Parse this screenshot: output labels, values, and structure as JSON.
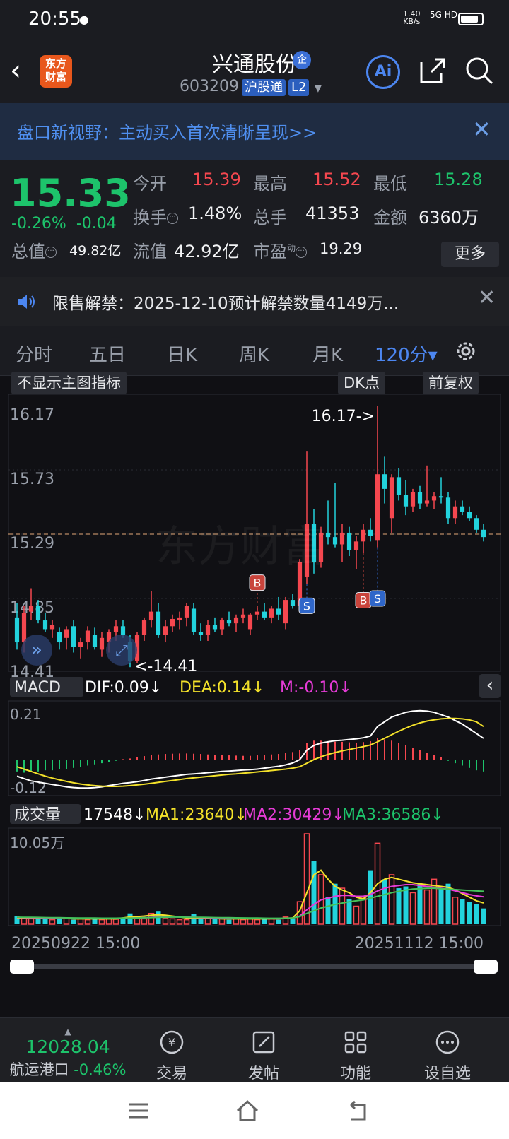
{
  "status_bar": {
    "time": "20:55",
    "rate_value": "1.40",
    "rate_unit": "KB/s",
    "network": "5G HD"
  },
  "header": {
    "title": "兴通股份",
    "badge": "企",
    "code": "603209",
    "exchange_tag": "沪股通",
    "level_tag": "L2",
    "logo_line1": "东方",
    "logo_line2": "财富",
    "ai_label": "Ai"
  },
  "banner": {
    "text": "盘口新视野：主动买入首次清晰呈现>>"
  },
  "quote": {
    "price": "15.33",
    "change_pct": "-0.26%",
    "change": "-0.04",
    "open_label": "今开",
    "open": "15.39",
    "high_label": "最高",
    "high": "15.52",
    "low_label": "最低",
    "low": "15.28",
    "turnover_label": "换手",
    "turnover": "1.48%",
    "volume_label": "总手",
    "volume": "41353",
    "amount_label": "金额",
    "amount": "6360万",
    "mktcap_label": "总值",
    "mktcap": "49.82亿",
    "float_label": "流值",
    "float": "42.92亿",
    "pe_label": "市盈",
    "pe_sup": "动",
    "pe": "19.29",
    "more_label": "更多"
  },
  "notice": {
    "text": "限售解禁：2025-12-10预计解禁数量4149万..."
  },
  "tabs": [
    "分时",
    "五日",
    "日K",
    "周K",
    "月K",
    "120分▾"
  ],
  "chart_controls": {
    "indicator": "不显示主图指标",
    "dk": "DK点",
    "adjust": "前复权"
  },
  "colors": {
    "up": "#f5474f",
    "down": "#22d3dd",
    "accent": "#4c86f0",
    "price_green": "#1dc36b",
    "yellow": "#f3e12a",
    "magenta": "#e63bd7"
  },
  "chart_data": [
    {
      "type": "candlestick",
      "y_ticks": [
        "16.17",
        "15.73",
        "15.29",
        "14.85",
        "14.41"
      ],
      "ylim": [
        14.41,
        16.17
      ],
      "current_price_line": 15.29,
      "annotations": {
        "high": "16.17->",
        "low": "<-14.41"
      },
      "signals": [
        {
          "label": "B",
          "index": 34,
          "price": 15.05
        },
        {
          "label": "S",
          "index": 41,
          "price": 14.95
        },
        {
          "label": "B",
          "index": 49,
          "price": 14.93
        },
        {
          "label": "S",
          "index": 51,
          "price": 15.0
        }
      ],
      "candles": [
        {
          "o": 14.72,
          "h": 14.82,
          "l": 14.5,
          "c": 14.55
        },
        {
          "o": 14.55,
          "h": 14.8,
          "l": 14.48,
          "c": 14.75
        },
        {
          "o": 14.76,
          "h": 14.92,
          "l": 14.7,
          "c": 14.8
        },
        {
          "o": 14.8,
          "h": 14.84,
          "l": 14.68,
          "c": 14.7
        },
        {
          "o": 14.7,
          "h": 14.75,
          "l": 14.62,
          "c": 14.64
        },
        {
          "o": 14.64,
          "h": 14.7,
          "l": 14.58,
          "c": 14.67
        },
        {
          "o": 14.62,
          "h": 14.65,
          "l": 14.5,
          "c": 14.55
        },
        {
          "o": 14.58,
          "h": 14.66,
          "l": 14.5,
          "c": 14.64
        },
        {
          "o": 14.66,
          "h": 14.7,
          "l": 14.48,
          "c": 14.52
        },
        {
          "o": 14.52,
          "h": 14.58,
          "l": 14.44,
          "c": 14.55
        },
        {
          "o": 14.55,
          "h": 14.66,
          "l": 14.5,
          "c": 14.63
        },
        {
          "o": 14.6,
          "h": 14.65,
          "l": 14.5,
          "c": 14.52
        },
        {
          "o": 14.5,
          "h": 14.62,
          "l": 14.45,
          "c": 14.58
        },
        {
          "o": 14.55,
          "h": 14.64,
          "l": 14.48,
          "c": 14.62
        },
        {
          "o": 14.62,
          "h": 14.7,
          "l": 14.56,
          "c": 14.66
        },
        {
          "o": 14.66,
          "h": 14.7,
          "l": 14.58,
          "c": 14.6
        },
        {
          "o": 14.55,
          "h": 14.6,
          "l": 14.38,
          "c": 14.42
        },
        {
          "o": 14.42,
          "h": 14.62,
          "l": 14.41,
          "c": 14.6
        },
        {
          "o": 14.6,
          "h": 14.72,
          "l": 14.56,
          "c": 14.7
        },
        {
          "o": 14.7,
          "h": 14.9,
          "l": 14.65,
          "c": 14.76
        },
        {
          "o": 14.76,
          "h": 14.82,
          "l": 14.58,
          "c": 14.6
        },
        {
          "o": 14.6,
          "h": 14.7,
          "l": 14.55,
          "c": 14.66
        },
        {
          "o": 14.66,
          "h": 14.74,
          "l": 14.62,
          "c": 14.71
        },
        {
          "o": 14.7,
          "h": 14.76,
          "l": 14.64,
          "c": 14.72
        },
        {
          "o": 14.72,
          "h": 14.82,
          "l": 14.66,
          "c": 14.8
        },
        {
          "o": 14.78,
          "h": 14.82,
          "l": 14.6,
          "c": 14.62
        },
        {
          "o": 14.62,
          "h": 14.68,
          "l": 14.56,
          "c": 14.6
        },
        {
          "o": 14.6,
          "h": 14.7,
          "l": 14.56,
          "c": 14.67
        },
        {
          "o": 14.67,
          "h": 14.72,
          "l": 14.62,
          "c": 14.64
        },
        {
          "o": 14.64,
          "h": 14.72,
          "l": 14.6,
          "c": 14.7
        },
        {
          "o": 14.7,
          "h": 14.76,
          "l": 14.66,
          "c": 14.68
        },
        {
          "o": 14.68,
          "h": 14.74,
          "l": 14.62,
          "c": 14.72
        },
        {
          "o": 14.72,
          "h": 14.78,
          "l": 14.68,
          "c": 14.74
        },
        {
          "o": 14.64,
          "h": 14.75,
          "l": 14.6,
          "c": 14.74
        },
        {
          "o": 14.74,
          "h": 14.8,
          "l": 14.7,
          "c": 14.76
        },
        {
          "o": 14.76,
          "h": 14.82,
          "l": 14.7,
          "c": 14.72
        },
        {
          "o": 14.72,
          "h": 14.8,
          "l": 14.68,
          "c": 14.78
        },
        {
          "o": 14.78,
          "h": 14.86,
          "l": 14.7,
          "c": 14.74
        },
        {
          "o": 14.68,
          "h": 14.86,
          "l": 14.64,
          "c": 14.84
        },
        {
          "o": 14.84,
          "h": 14.88,
          "l": 14.78,
          "c": 14.8
        },
        {
          "o": 14.8,
          "h": 15.12,
          "l": 14.78,
          "c": 15.1
        },
        {
          "o": 15.0,
          "h": 15.86,
          "l": 14.95,
          "c": 15.36
        },
        {
          "o": 15.36,
          "h": 15.46,
          "l": 15.02,
          "c": 15.1
        },
        {
          "o": 15.1,
          "h": 15.34,
          "l": 15.06,
          "c": 15.3
        },
        {
          "o": 15.3,
          "h": 15.52,
          "l": 15.22,
          "c": 15.27
        },
        {
          "o": 15.27,
          "h": 15.64,
          "l": 15.2,
          "c": 15.22
        },
        {
          "o": 15.22,
          "h": 15.36,
          "l": 15.1,
          "c": 15.3
        },
        {
          "o": 15.3,
          "h": 15.34,
          "l": 15.14,
          "c": 15.18
        },
        {
          "o": 15.18,
          "h": 15.28,
          "l": 15.05,
          "c": 15.24
        },
        {
          "o": 15.24,
          "h": 15.36,
          "l": 15.16,
          "c": 15.32
        },
        {
          "o": 15.32,
          "h": 15.4,
          "l": 15.24,
          "c": 15.28
        },
        {
          "o": 15.25,
          "h": 16.17,
          "l": 15.2,
          "c": 15.7
        },
        {
          "o": 15.7,
          "h": 15.82,
          "l": 15.5,
          "c": 15.6
        },
        {
          "o": 15.4,
          "h": 15.7,
          "l": 15.3,
          "c": 15.68
        },
        {
          "o": 15.68,
          "h": 15.74,
          "l": 15.52,
          "c": 15.56
        },
        {
          "o": 15.56,
          "h": 15.66,
          "l": 15.42,
          "c": 15.48
        },
        {
          "o": 15.48,
          "h": 15.6,
          "l": 15.44,
          "c": 15.58
        },
        {
          "o": 15.58,
          "h": 15.62,
          "l": 15.46,
          "c": 15.5
        },
        {
          "o": 15.5,
          "h": 15.76,
          "l": 15.48,
          "c": 15.52
        },
        {
          "o": 15.52,
          "h": 15.58,
          "l": 15.46,
          "c": 15.55
        },
        {
          "o": 15.55,
          "h": 15.68,
          "l": 15.5,
          "c": 15.54
        },
        {
          "o": 15.54,
          "h": 15.58,
          "l": 15.36,
          "c": 15.4
        },
        {
          "o": 15.4,
          "h": 15.52,
          "l": 15.36,
          "c": 15.48
        },
        {
          "o": 15.48,
          "h": 15.52,
          "l": 15.42,
          "c": 15.44
        },
        {
          "o": 15.44,
          "h": 15.48,
          "l": 15.38,
          "c": 15.4
        },
        {
          "o": 15.4,
          "h": 15.42,
          "l": 15.3,
          "c": 15.32
        },
        {
          "o": 15.32,
          "h": 15.36,
          "l": 15.24,
          "c": 15.27
        }
      ]
    },
    {
      "type": "bar",
      "name": "MACD",
      "legend": {
        "title": "MACD",
        "dif": "DIF:0.09↓",
        "dea": "DEA:0.14↓",
        "m": "M:-0.10↓"
      },
      "y_ticks": [
        "0.21",
        "-0.12"
      ],
      "ylim": [
        -0.14,
        0.23
      ],
      "histogram": [
        -0.05,
        -0.055,
        -0.05,
        -0.05,
        -0.045,
        -0.045,
        -0.04,
        -0.04,
        -0.035,
        -0.03,
        -0.025,
        -0.02,
        -0.015,
        -0.01,
        -0.005,
        0.002,
        0.005,
        0.01,
        0.015,
        0.02,
        0.022,
        0.024,
        0.025,
        0.026,
        0.026,
        0.025,
        0.024,
        0.022,
        0.02,
        0.019,
        0.018,
        0.017,
        0.016,
        0.016,
        0.018,
        0.02,
        0.022,
        0.024,
        0.028,
        0.032,
        0.04,
        0.07,
        0.08,
        0.08,
        0.078,
        0.076,
        0.075,
        0.073,
        0.072,
        0.074,
        0.078,
        0.09,
        0.085,
        0.08,
        0.07,
        0.06,
        0.05,
        0.04,
        0.03,
        0.02,
        0.01,
        -0.005,
        -0.015,
        -0.025,
        -0.035,
        -0.045,
        -0.05
      ],
      "dif": [
        -0.07,
        -0.08,
        -0.09,
        -0.095,
        -0.1,
        -0.105,
        -0.11,
        -0.115,
        -0.118,
        -0.12,
        -0.12,
        -0.118,
        -0.115,
        -0.11,
        -0.105,
        -0.1,
        -0.097,
        -0.093,
        -0.088,
        -0.082,
        -0.078,
        -0.074,
        -0.07,
        -0.066,
        -0.062,
        -0.06,
        -0.058,
        -0.055,
        -0.053,
        -0.05,
        -0.048,
        -0.046,
        -0.044,
        -0.042,
        -0.04,
        -0.036,
        -0.032,
        -0.028,
        -0.022,
        -0.014,
        0.0,
        0.04,
        0.06,
        0.07,
        0.075,
        0.08,
        0.082,
        0.085,
        0.088,
        0.092,
        0.1,
        0.14,
        0.16,
        0.18,
        0.19,
        0.2,
        0.205,
        0.207,
        0.205,
        0.2,
        0.19,
        0.18,
        0.165,
        0.15,
        0.13,
        0.11,
        0.09
      ],
      "dea": [
        -0.03,
        -0.04,
        -0.05,
        -0.06,
        -0.07,
        -0.078,
        -0.085,
        -0.092,
        -0.098,
        -0.103,
        -0.107,
        -0.11,
        -0.112,
        -0.113,
        -0.113,
        -0.112,
        -0.11,
        -0.107,
        -0.104,
        -0.1,
        -0.096,
        -0.092,
        -0.088,
        -0.084,
        -0.08,
        -0.077,
        -0.074,
        -0.071,
        -0.068,
        -0.065,
        -0.062,
        -0.06,
        -0.057,
        -0.055,
        -0.052,
        -0.049,
        -0.046,
        -0.043,
        -0.04,
        -0.036,
        -0.03,
        -0.015,
        0.0,
        0.012,
        0.022,
        0.03,
        0.037,
        0.043,
        0.049,
        0.055,
        0.062,
        0.075,
        0.09,
        0.105,
        0.12,
        0.133,
        0.145,
        0.155,
        0.163,
        0.168,
        0.172,
        0.174,
        0.174,
        0.172,
        0.168,
        0.16,
        0.14
      ]
    },
    {
      "type": "bar",
      "name": "成交量",
      "legend": {
        "title": "成交量",
        "vol": "17548↓",
        "ma1": "MA1:23640↓",
        "ma2": "MA2:30429↓",
        "ma3": "MA3:36586↓"
      },
      "y_ticks": [
        "10.05万"
      ],
      "ylim": [
        0,
        100500
      ],
      "x_ticks": [
        "20250922 15:00",
        "20251112 15:00"
      ],
      "volumes": [
        9000,
        7000,
        6000,
        8000,
        7000,
        5000,
        6000,
        7000,
        5000,
        6000,
        5000,
        6000,
        5000,
        6000,
        5500,
        7000,
        12000,
        8000,
        6000,
        12000,
        14000,
        7000,
        6000,
        5000,
        5000,
        11000,
        6000,
        7000,
        6000,
        6000,
        5000,
        6000,
        5000,
        6000,
        5000,
        6000,
        6000,
        5000,
        8000,
        6000,
        25000,
        100500,
        70000,
        55000,
        30000,
        45000,
        40000,
        28000,
        20000,
        30000,
        60000,
        90000,
        50000,
        55000,
        40000,
        42000,
        35000,
        45000,
        38000,
        50000,
        40000,
        45000,
        30000,
        28000,
        25000,
        22000,
        17548
      ],
      "ma1": [
        7000,
        7000,
        7000,
        7000,
        7000,
        6500,
        6500,
        6500,
        6000,
        6000,
        6000,
        6000,
        6000,
        6000,
        6000,
        7000,
        8000,
        8500,
        9000,
        10000,
        10500,
        10000,
        9000,
        8000,
        7000,
        7000,
        6500,
        6500,
        6500,
        6000,
        6000,
        6000,
        6000,
        6000,
        6000,
        6000,
        6000,
        6000,
        6500,
        7000,
        15000,
        35000,
        55000,
        60000,
        50000,
        42000,
        38000,
        35000,
        30000,
        28000,
        35000,
        45000,
        50000,
        52000,
        50000,
        48000,
        46000,
        45000,
        44000,
        43000,
        42000,
        41000,
        38000,
        34000,
        30000,
        26000,
        23640
      ],
      "ma2": [
        7500,
        7400,
        7300,
        7200,
        7100,
        7000,
        6900,
        6800,
        6700,
        6600,
        6500,
        6500,
        6400,
        6400,
        6400,
        6500,
        6700,
        7000,
        7200,
        7600,
        8000,
        8200,
        8200,
        8000,
        7800,
        7600,
        7400,
        7200,
        7000,
        6900,
        6800,
        6700,
        6600,
        6500,
        6400,
        6300,
        6200,
        6200,
        6300,
        6600,
        9000,
        16000,
        22000,
        27000,
        29000,
        31000,
        32000,
        32000,
        31000,
        31000,
        33000,
        37000,
        40000,
        42000,
        43000,
        44000,
        44000,
        43000,
        42000,
        41000,
        40000,
        39000,
        37000,
        35000,
        33000,
        31500,
        30429
      ],
      "ma3": [
        7800,
        7700,
        7600,
        7500,
        7400,
        7300,
        7200,
        7100,
        7000,
        6900,
        6800,
        6800,
        6700,
        6700,
        6700,
        6800,
        6900,
        7000,
        7200,
        7400,
        7600,
        7800,
        7900,
        7900,
        7800,
        7700,
        7600,
        7500,
        7400,
        7300,
        7200,
        7100,
        7000,
        6900,
        6800,
        6700,
        6600,
        6600,
        6700,
        6900,
        8500,
        12000,
        15000,
        18000,
        20000,
        22000,
        23500,
        25000,
        26000,
        27000,
        29000,
        31000,
        33000,
        35000,
        36500,
        38000,
        39000,
        39500,
        40000,
        40000,
        39500,
        39000,
        38500,
        38000,
        37500,
        37000,
        36586
      ]
    }
  ],
  "bottom_nav": {
    "index_value": "12028.04",
    "index_name": "航运港口",
    "index_change": "-0.46%",
    "items": [
      "交易",
      "发帖",
      "功能",
      "设自选"
    ]
  }
}
